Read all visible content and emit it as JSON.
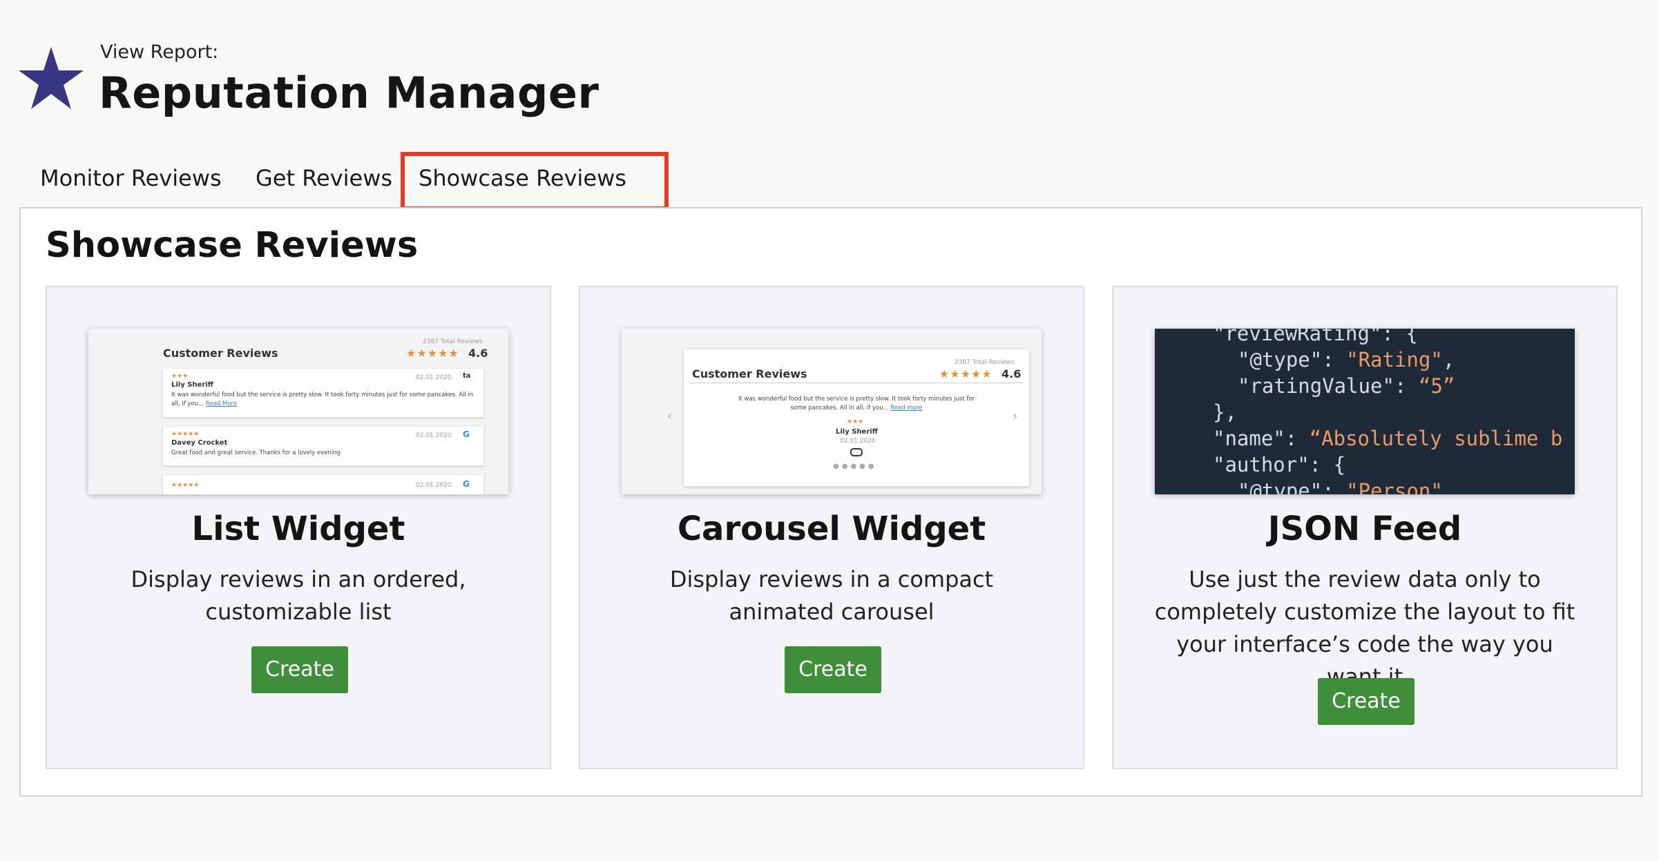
{
  "header": {
    "subtitle": "View Report:",
    "title": "Reputation Manager",
    "logo_icon": "star-icon",
    "logo_color": "#3a3683"
  },
  "tabs": [
    {
      "label": "Monitor Reviews",
      "active": false
    },
    {
      "label": "Get Reviews",
      "active": false
    },
    {
      "label": "Showcase Reviews",
      "active": true
    }
  ],
  "highlight_color": "#e13d2a",
  "panel": {
    "title": "Showcase Reviews",
    "cards": [
      {
        "title": "List Widget",
        "description": "Display reviews in an ordered, customizable list",
        "button": "Create",
        "preview": {
          "header": "Customer Reviews",
          "total": "2387 Total Reviews",
          "stars": "★★★★★",
          "rating": "4.6",
          "reviews": [
            {
              "stars": "★★★",
              "name": "Lily Sheriff",
              "date": "02.01.2020",
              "text": "It was wonderful food but the service is pretty slow. It took forty minutes just for some pancakes. All in all, if you...",
              "link": "Read More",
              "source": "ta"
            },
            {
              "stars": "★★★★★",
              "name": "Davey Crocket",
              "date": "02.01.2020",
              "text": "Great food and great service. Thanks for a lovely evening",
              "source": "G"
            },
            {
              "stars": "★★★★★",
              "date": "02.01.2020",
              "source": "G"
            }
          ]
        }
      },
      {
        "title": "Carousel Widget",
        "description": "Display reviews in a compact animated carousel",
        "button": "Create",
        "preview": {
          "header": "Customer Reviews",
          "total": "2387 Total Reviews",
          "stars": "★★★★★",
          "rating": "4.6",
          "text": "It was wonderful food but the service is pretty slow. It took forty minutes just for some pancakes. All in all, if you...",
          "link": "Read more",
          "review_stars": "★★★",
          "name": "Lily Sheriff",
          "date": "02.01.2020",
          "dots": "●●●●●"
        }
      },
      {
        "title": "JSON Feed",
        "description": "Use just the review data only to completely customize the layout to fit your interface’s code the way you want it",
        "button": "Create",
        "preview": {
          "line1_key": "\"reviewRating\": {",
          "line2_key": "\"@type\": ",
          "line2_val": "\"Rating\"",
          "line2_end": ",",
          "line3_key": "\"ratingValue\": ",
          "line3_val": "“5”",
          "line4": "},",
          "line5_key": "\"name\": ",
          "line5_val": "“Absolutely sublime b",
          "line6_key": "\"author\": {",
          "line7_key": "\"@type\": ",
          "line7_val": "\"Person\""
        }
      }
    ]
  },
  "colors": {
    "button_green": "#3e8e3a",
    "accent_orange": "#e8913a",
    "code_bg": "#1e2a38"
  }
}
